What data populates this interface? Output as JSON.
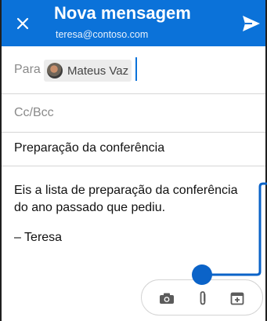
{
  "header": {
    "title": "Nova mensagem",
    "account": "teresa@contoso.com",
    "close_icon": "close-icon",
    "send_icon": "send-icon"
  },
  "to": {
    "label": "Para",
    "recipients": [
      {
        "name": "Mateus Vaz"
      }
    ]
  },
  "cc": {
    "label": "Cc/Bcc"
  },
  "subject": {
    "value": "Preparação da conferência"
  },
  "body": {
    "text": "Eis a lista de preparação da conferência do ano passado que pediu.",
    "signature": "– Teresa"
  },
  "toolbar": {
    "icons": [
      "camera-icon",
      "attach-icon",
      "calendar-add-icon"
    ]
  },
  "colors": {
    "accent": "#0b72d9",
    "callout": "#0b63c8",
    "divider": "#d6d6d6"
  }
}
